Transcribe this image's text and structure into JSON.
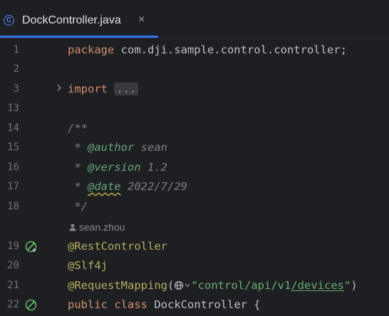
{
  "tab": {
    "icon": "class-icon",
    "icon_letter": "C",
    "title": "DockController.java",
    "close": "×"
  },
  "author_hint": "sean.zhou",
  "lines": [
    {
      "n": "1",
      "text": "package com.dji.sample.control.controller;"
    },
    {
      "n": "2",
      "text": ""
    },
    {
      "n": "3",
      "text": "import ..."
    },
    {
      "n": "13",
      "text": ""
    },
    {
      "n": "14",
      "text": "/**"
    },
    {
      "n": "15",
      "text": " * @author sean"
    },
    {
      "n": "16",
      "text": " * @version 1.2"
    },
    {
      "n": "17",
      "text": " * @date 2022/7/29"
    },
    {
      "n": "18",
      "text": " */"
    },
    {
      "n": "19",
      "text": "@RestController"
    },
    {
      "n": "20",
      "text": "@Slf4j"
    },
    {
      "n": "21",
      "text": "@RequestMapping(\"control/api/v1/devices\")"
    },
    {
      "n": "22",
      "text": "public class DockController {"
    }
  ],
  "tokens": {
    "package_kw": "package",
    "package_name": " com.dji.sample.control.controller;",
    "import_kw": "import",
    "import_fold": "...",
    "doc_open": "/**",
    "author_prefix": " * ",
    "author_tag": "@author",
    "author_val": " sean",
    "version_prefix": " * ",
    "version_tag": "@version",
    "version_val": " 1.2",
    "date_prefix": " * ",
    "date_tag": "@date",
    "date_val": " 2022/7/29",
    "doc_close": " */",
    "rest_ann": "@RestController",
    "slf_ann": "@Slf4j",
    "rm_ann": "@RequestMapping",
    "rm_open": "(",
    "rm_str_q1": "\"",
    "rm_str_a": "control/api/v1",
    "rm_str_b": "/devices",
    "rm_str_q2": "\"",
    "rm_close": ")",
    "public_kw": "public",
    "class_kw": " class",
    "class_name": " DockController {"
  },
  "icons": {
    "fold_arrow": "chevron-right-icon",
    "gutter_19": "spring-bean-icon",
    "gutter_22": "spring-bean-icon",
    "inlay": "globe-icon",
    "author": "user-icon"
  },
  "colors": {
    "background": "#1e1f22",
    "keyword": "#cf8e6d",
    "annotation": "#b3ae60",
    "string": "#6aab73",
    "comment": "#7a7e85",
    "doc_tag": "#67a37c",
    "accent": "#3574f0"
  }
}
